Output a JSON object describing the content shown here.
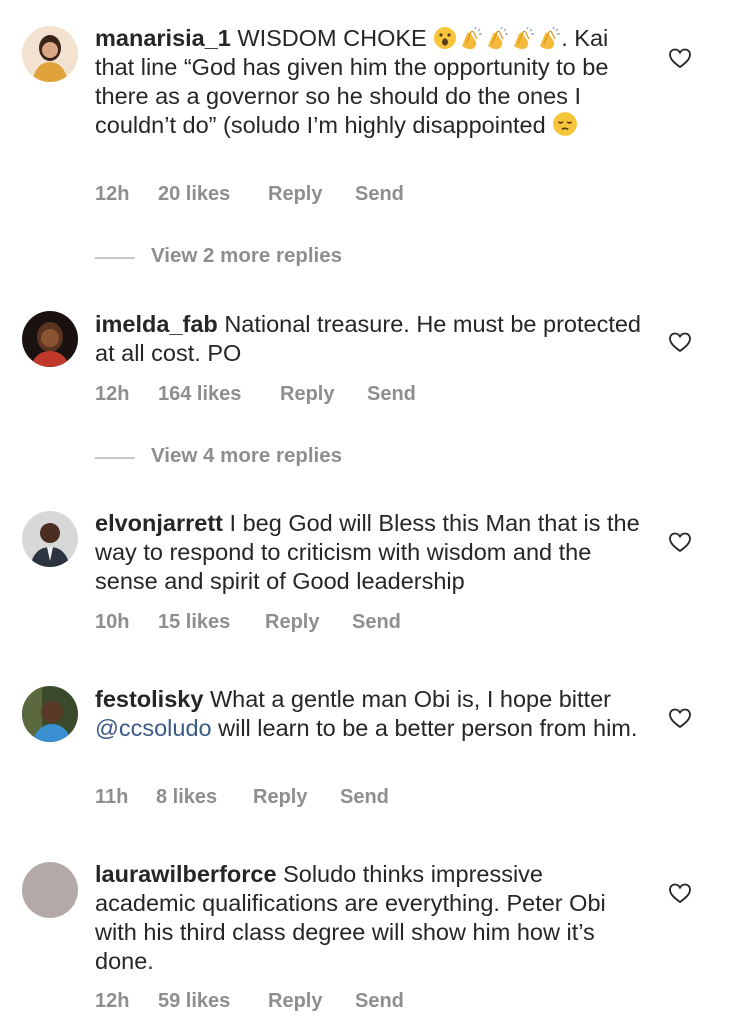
{
  "comments": [
    {
      "username": "manarisia_1",
      "text_before": "WISDOM CHOKE",
      "emojis": [
        "astonished-face",
        "clapping-hands",
        "clapping-hands",
        "clapping-hands",
        "clapping-hands"
      ],
      "text_after": ". Kai that line “God has given him the opportunity to be there as a governor so he should do the ones I couldn’t do” (soludo I’m highly disappointed",
      "end_emoji": "pensive-face",
      "time": "12h",
      "likes": "20 likes",
      "reply": "Reply",
      "send": "Send",
      "view_replies": "View 2 more replies",
      "avatar_color": "#d49a3a"
    },
    {
      "username": "imelda_fab",
      "text": "National treasure. He must be protected at all cost. PO",
      "time": "12h",
      "likes": "164 likes",
      "reply": "Reply",
      "send": "Send",
      "view_replies": "View 4 more replies",
      "avatar_color": "#4a2a1c"
    },
    {
      "username": "elvonjarrett",
      "text": "I beg God will Bless this Man that is the way to respond to criticism with wisdom and the sense and spirit of Good leadership",
      "time": "10h",
      "likes": "15 likes",
      "reply": "Reply",
      "send": "Send",
      "avatar_color": "#3e4a5c"
    },
    {
      "username": "festolisky",
      "text_before": "What a gentle man Obi is, I hope bitter",
      "mention": "@ccsoludo",
      "text_after": "will learn to be a better person from him.",
      "time": "11h",
      "likes": "8 likes",
      "reply": "Reply",
      "send": "Send",
      "avatar_color": "#2f3b24"
    },
    {
      "username": "laurawilberforce",
      "text": "Soludo thinks impressive academic qualifications are everything. Peter Obi with his third class degree will show him how it’s done.",
      "time": "12h",
      "likes": "59 likes",
      "reply": "Reply",
      "send": "Send",
      "avatar_color": "#b3aaa7"
    }
  ],
  "colors": {
    "text": "#262626",
    "meta": "#8e8e8e",
    "mention": "#3b5a86"
  },
  "icons": {
    "like": "heart-outline-icon"
  }
}
